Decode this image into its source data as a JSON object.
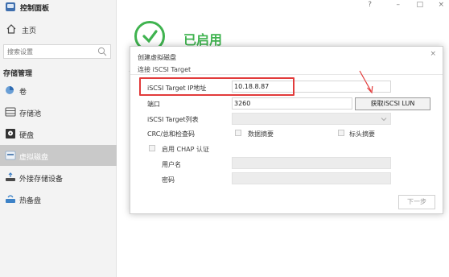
{
  "app": {
    "title": "控制面板"
  },
  "window_controls": {
    "help": "?",
    "minimize": "–",
    "maximize": "□",
    "close": "×"
  },
  "sidebar": {
    "home_label": "主页",
    "search_placeholder": "搜索设置",
    "section_title": "存储管理",
    "items": [
      {
        "label": "卷",
        "icon": "volume-icon"
      },
      {
        "label": "存储池",
        "icon": "storage-pool-icon"
      },
      {
        "label": "硬盘",
        "icon": "hard-disk-icon"
      },
      {
        "label": "虚拟磁盘",
        "icon": "virtual-disk-icon",
        "active": true
      },
      {
        "label": "外接存储设备",
        "icon": "external-storage-icon"
      },
      {
        "label": "热备盘",
        "icon": "hot-spare-icon"
      }
    ]
  },
  "status": {
    "text": "已启用",
    "color": "#3fb34f"
  },
  "dialog": {
    "title": "创建虚拟磁盘",
    "close": "×",
    "subtitle": "连接 iSCSI Target",
    "target_ip_label": "iSCSI Target IP地址",
    "target_ip_value": "10.18.8.87",
    "port_label": "端口",
    "port_value": "3260",
    "fetch_button": "获取iSCSI LUN",
    "target_list_label": "iSCSI Target列表",
    "checksum_label": "CRC/总和检查码",
    "data_digest_label": "数据摘要",
    "header_digest_label": "标头摘要",
    "chap_label": "启用 CHAP 认证",
    "username_label": "用户名",
    "password_label": "密码",
    "next_button": "下一步"
  },
  "colors": {
    "highlight": "#e23b3b",
    "accent": "#3fb34f",
    "active_nav": "#c9c9c9"
  }
}
